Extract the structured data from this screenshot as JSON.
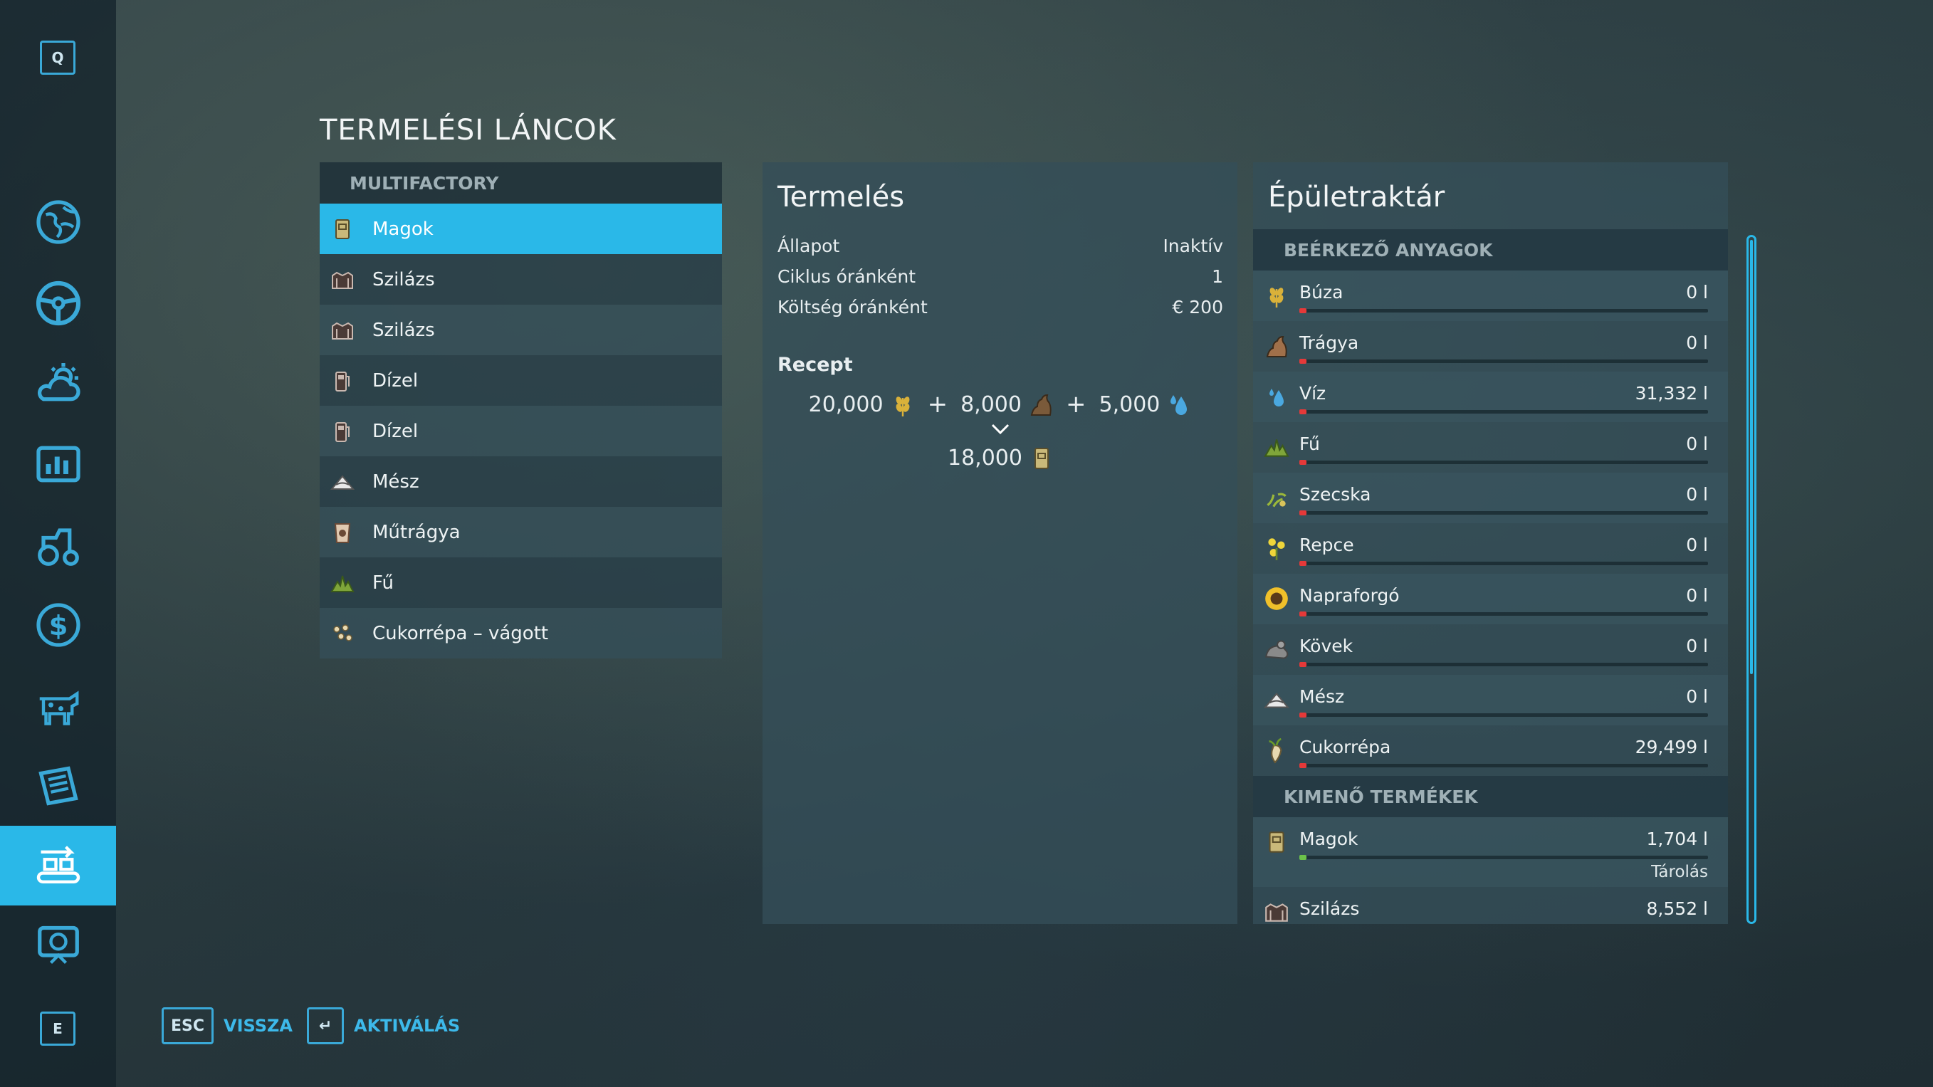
{
  "sidebar": {
    "top_key": "Q",
    "bottom_key": "E",
    "items": [
      {
        "icon": "globe-map-icon",
        "active": false
      },
      {
        "icon": "steering-wheel-icon",
        "active": false
      },
      {
        "icon": "weather-icon",
        "active": false
      },
      {
        "icon": "statistics-icon",
        "active": false
      },
      {
        "icon": "tractor-icon",
        "active": false
      },
      {
        "icon": "finance-icon",
        "active": false
      },
      {
        "icon": "animals-icon",
        "active": false
      },
      {
        "icon": "contracts-icon",
        "active": false
      },
      {
        "icon": "production-chains-icon",
        "active": true
      },
      {
        "icon": "help-icon",
        "active": false
      }
    ]
  },
  "page_title": "TERMELÉSI LÁNCOK",
  "chains": {
    "header": "MULTIFACTORY",
    "items": [
      {
        "label": "Magok",
        "icon": "seed-bag-icon",
        "selected": true
      },
      {
        "label": "Szilázs",
        "icon": "silage-icon",
        "selected": false
      },
      {
        "label": "Szilázs",
        "icon": "silage-icon",
        "selected": false
      },
      {
        "label": "Dízel",
        "icon": "fuel-icon",
        "selected": false
      },
      {
        "label": "Dízel",
        "icon": "fuel-icon",
        "selected": false
      },
      {
        "label": "Mész",
        "icon": "lime-icon",
        "selected": false
      },
      {
        "label": "Műtrágya",
        "icon": "fertilizer-icon",
        "selected": false
      },
      {
        "label": "Fű",
        "icon": "grass-icon",
        "selected": false
      },
      {
        "label": "Cukorrépa – vágott",
        "icon": "sugarbeet-cut-icon",
        "selected": false
      }
    ]
  },
  "production": {
    "title": "Termelés",
    "stats": [
      {
        "label": "Állapot",
        "value": "Inaktív"
      },
      {
        "label": "Ciklus óránként",
        "value": "1"
      },
      {
        "label": "Költség óránként",
        "value": "€ 200"
      }
    ],
    "recipe_title": "Recept",
    "recipe_inputs": [
      {
        "amount": "20,000",
        "icon": "wheat-icon"
      },
      {
        "amount": "8,000",
        "icon": "manure-icon"
      },
      {
        "amount": "5,000",
        "icon": "water-icon"
      }
    ],
    "recipe_plus": "+",
    "recipe_output": {
      "amount": "18,000",
      "icon": "seed-bag-icon"
    }
  },
  "storage": {
    "title": "Épületraktár",
    "incoming_header": "BEÉRKEZŐ ANYAGOK",
    "incoming": [
      {
        "name": "Búza",
        "amount": "0 l",
        "icon": "wheat-icon",
        "fill": 0
      },
      {
        "name": "Trágya",
        "amount": "0 l",
        "icon": "manure-icon",
        "fill": 0
      },
      {
        "name": "Víz",
        "amount": "31,332 l",
        "icon": "water-icon",
        "fill": 0
      },
      {
        "name": "Fű",
        "amount": "0 l",
        "icon": "grass-icon",
        "fill": 0
      },
      {
        "name": "Szecska",
        "amount": "0 l",
        "icon": "chaff-icon",
        "fill": 0
      },
      {
        "name": "Repce",
        "amount": "0 l",
        "icon": "canola-icon",
        "fill": 0
      },
      {
        "name": "Napraforgó",
        "amount": "0 l",
        "icon": "sunflower-icon",
        "fill": 0
      },
      {
        "name": "Kövek",
        "amount": "0 l",
        "icon": "stones-icon",
        "fill": 0
      },
      {
        "name": "Mész",
        "amount": "0 l",
        "icon": "lime-icon",
        "fill": 0
      },
      {
        "name": "Cukorrépa",
        "amount": "29,499 l",
        "icon": "sugarbeet-icon",
        "fill": 0
      }
    ],
    "outgoing_header": "KIMENŐ TERMÉKEK",
    "outgoing": [
      {
        "name": "Magok",
        "amount": "1,704 l",
        "icon": "seed-bag-icon",
        "mode": "Tárolás"
      },
      {
        "name": "Szilázs",
        "amount": "8,552 l",
        "icon": "silage-icon",
        "mode": ""
      }
    ]
  },
  "footer": {
    "back_key": "ESC",
    "back_label": "VISSZA",
    "activate_key": "↵",
    "activate_label": "AKTIVÁLÁS"
  },
  "colors": {
    "accent": "#2ab8e8",
    "bar_empty": "#e53939",
    "bar_output": "#6cc24a"
  }
}
